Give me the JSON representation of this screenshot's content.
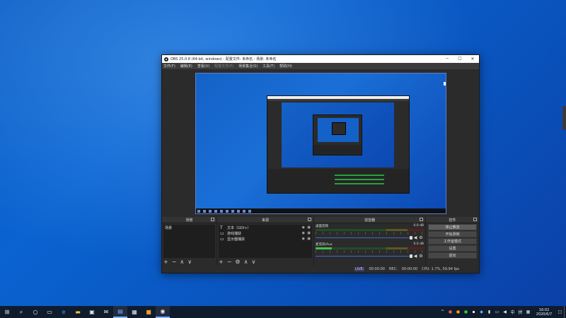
{
  "window": {
    "title": "OBS 25.0.8 (64-bit, windows) - 配置文件: 未命名 - 场景: 未命名",
    "minimize": "─",
    "maximize": "☐",
    "close": "✕"
  },
  "menu": [
    {
      "label": "文件(F)",
      "enabled": true
    },
    {
      "label": "编辑(E)",
      "enabled": true
    },
    {
      "label": "查看(V)",
      "enabled": true
    },
    {
      "label": "配置文件(P)",
      "enabled": false
    },
    {
      "label": "场景集合(S)",
      "enabled": true
    },
    {
      "label": "工具(T)",
      "enabled": true
    },
    {
      "label": "帮助(H)",
      "enabled": true
    }
  ],
  "docks": {
    "scenes": {
      "title": "场景",
      "items": [
        "场景"
      ]
    },
    "sources": {
      "title": "来源",
      "items": [
        {
          "icon": "T",
          "label": "文本（GDI+）"
        },
        {
          "icon": "▭",
          "label": "游戏捕获"
        },
        {
          "icon": "▭",
          "label": "显示器捕获"
        }
      ]
    },
    "mixer": {
      "title": "混音器",
      "channels": [
        {
          "name": "桌面音频",
          "db": "0.0 dB",
          "level": 0
        },
        {
          "name": "麦克风/Aux",
          "db": "0.0 dB",
          "level": 0.15
        }
      ]
    },
    "controls": {
      "title": "控件",
      "buttons": [
        "停止推流",
        "开始录制",
        "工作室模式",
        "设置",
        "退出"
      ]
    }
  },
  "tools": {
    "add": "+",
    "remove": "−",
    "settings": "⚙",
    "up": "∧",
    "down": "∨"
  },
  "status": {
    "live": "LIVE:",
    "live_time": "00:00:00",
    "rec": "REC:",
    "rec_time": "00:00:00",
    "cpu": "CPU: 1.7%, 59.94 fps"
  },
  "taskbar": {
    "icons": [
      "start-icon",
      "search-icon",
      "cortana-icon",
      "task-view-icon",
      "edge-icon",
      "file-explorer-icon",
      "store-icon",
      "mail-icon",
      "photos-icon",
      "screen-app-icon",
      "sublime-icon",
      "obs-icon"
    ],
    "clock_time": "16:02",
    "clock_date": "2020/6/7"
  }
}
